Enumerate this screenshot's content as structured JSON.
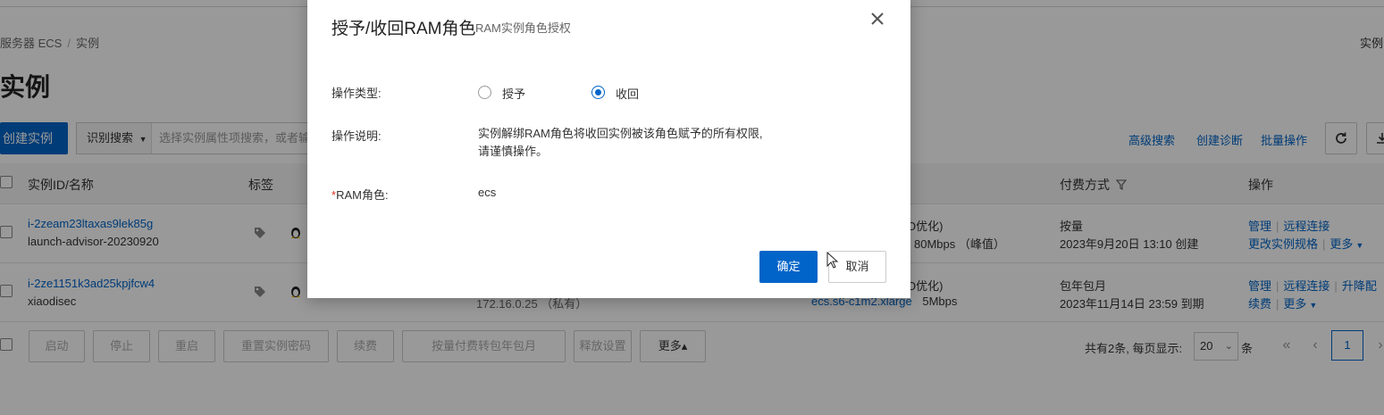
{
  "breadcrumb": {
    "items": [
      "服务器 ECS",
      "实例"
    ],
    "separator": "/",
    "right_text": "实例"
  },
  "page": {
    "title": "实例"
  },
  "toolbar": {
    "create_label": "创建实例",
    "search_type": "识别搜索",
    "search_placeholder": "选择实例属性项搜索，或者输",
    "advanced_search": "高级搜索",
    "create_diagnosis": "创建诊断",
    "batch_ops": "批量操作",
    "refresh_icon": "refresh-icon",
    "download_icon": "download-icon"
  },
  "table": {
    "headers": {
      "id_name": "实例ID/名称",
      "tags": "标签",
      "billing": "付费方式",
      "actions": "操作"
    },
    "rows": [
      {
        "id": "i-2zeam23ltaxas9lek85g",
        "name": "launch-advisor-20230920",
        "spec_line1": "O优化)",
        "spec_line2": "80Mbps （峰值）",
        "billing_type": "按量",
        "billing_time": "2023年9月20日 13:10 创建",
        "action_manage": "管理",
        "action_remote": "远程连接",
        "action_change_spec": "更改实例规格",
        "action_more": "更多"
      },
      {
        "id": "i-2ze1151k3ad25kpjfcw4",
        "name": "xiaodisec",
        "ip_partial": "172.16.0.25 （私有）",
        "spec_line1": "O优化)",
        "spec_type": "ecs.s6-c1m2.xlarge",
        "bandwidth": "5Mbps",
        "billing_type": "包年包月",
        "billing_time": "2023年11月14日 23:59 到期",
        "action_manage": "管理",
        "action_remote": "远程连接",
        "action_upgrade": "升降配",
        "action_renew": "续费",
        "action_more": "更多"
      }
    ]
  },
  "footer": {
    "buttons": [
      "启动",
      "停止",
      "重启",
      "重置实例密码",
      "续费",
      "按量付费转包年包月",
      "释放设置",
      "更多▴"
    ],
    "pager_text": "共有2条, 每页显示:",
    "page_size": "20",
    "page_size_suffix": "条",
    "first": "«",
    "prev": "‹",
    "current_page": "1",
    "next": "›"
  },
  "modal": {
    "title": "授予/收回RAM角色",
    "subtitle": "RAM实例角色授权",
    "op_type_label": "操作类型:",
    "option_grant": "授予",
    "option_revoke": "收回",
    "selected": "收回",
    "desc_label": "操作说明:",
    "desc_line1": "实例解绑RAM角色将收回实例被该角色赋予的所有权限,",
    "desc_line2": "请谨慎操作。",
    "role_required_mark": "*",
    "role_label": "RAM角色:",
    "role_value": "ecs",
    "confirm": "确定",
    "cancel": "取消"
  },
  "colors": {
    "primary": "#0064c8",
    "overlay": "rgba(0,0,0,0.40)",
    "required": "#d93026"
  }
}
